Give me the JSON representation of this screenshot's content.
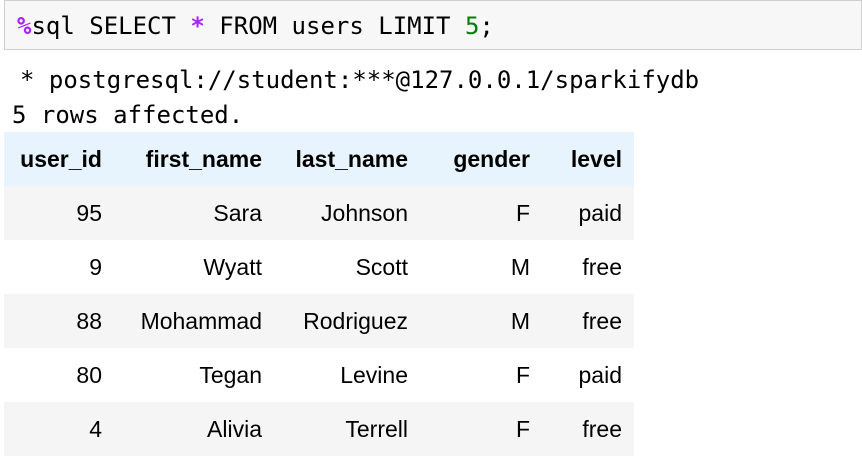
{
  "input_cell": {
    "magic": "%",
    "keyword_sql": "sql",
    "select": " SELECT ",
    "star": "*",
    "from_clause": " FROM users LIMIT ",
    "limit_value": "5",
    "terminator": ";"
  },
  "output": {
    "connection_line": "* postgresql://student:***@127.0.0.1/sparkifydb",
    "rows_affected": "5 rows affected."
  },
  "table": {
    "headers": [
      "user_id",
      "first_name",
      "last_name",
      "gender",
      "level"
    ],
    "rows": [
      [
        "95",
        "Sara",
        "Johnson",
        "F",
        "paid"
      ],
      [
        "9",
        "Wyatt",
        "Scott",
        "M",
        "free"
      ],
      [
        "88",
        "Mohammad",
        "Rodriguez",
        "M",
        "free"
      ],
      [
        "80",
        "Tegan",
        "Levine",
        "F",
        "paid"
      ],
      [
        "4",
        "Alivia",
        "Terrell",
        "F",
        "free"
      ]
    ]
  },
  "colors": {
    "magic": "#aa22ff",
    "number": "#008000",
    "header_bg": "#e8f4fd",
    "stripe_bg": "#f5f5f5"
  }
}
